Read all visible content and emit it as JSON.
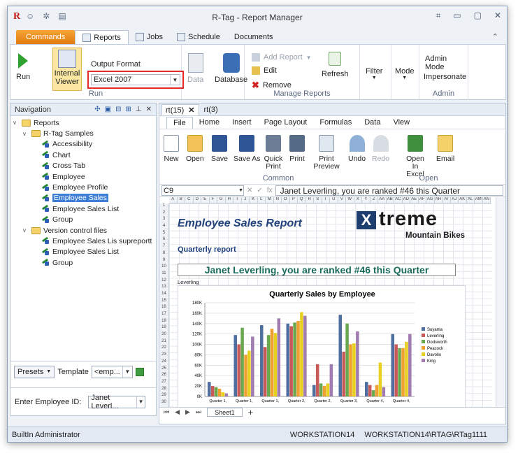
{
  "window": {
    "title": "R-Tag - Report Manager"
  },
  "tabs": [
    {
      "label": "Commands"
    },
    {
      "label": "Reports"
    },
    {
      "label": "Jobs"
    },
    {
      "label": "Schedule"
    },
    {
      "label": "Documents"
    }
  ],
  "ribbon": {
    "run": "Run",
    "internal_viewer": "Internal Viewer",
    "output_format_label": "Output Format",
    "output_format_value": "Excel 2007",
    "run_group": "Run",
    "data": "Data",
    "database": "Database",
    "add_report": "Add Report",
    "edit": "Edit",
    "remove": "Remove",
    "refresh": "Refresh",
    "manage_group": "Manage Reports",
    "filter": "Filter",
    "mode": "Mode",
    "admin_mode": "Admin Mode",
    "impersonate": "Impersonate",
    "admin_group": "Admin"
  },
  "navigation": {
    "title": "Navigation",
    "items": [
      {
        "label": "Reports",
        "level": 0,
        "type": "folder",
        "toggle": "v"
      },
      {
        "label": "R-Tag Samples",
        "level": 1,
        "type": "folder",
        "toggle": "v"
      },
      {
        "label": "Accessibility",
        "level": 2,
        "type": "report"
      },
      {
        "label": "Chart",
        "level": 2,
        "type": "report"
      },
      {
        "label": "Cross Tab",
        "level": 2,
        "type": "report"
      },
      {
        "label": "Employee",
        "level": 2,
        "type": "report2"
      },
      {
        "label": "Employee  Profile",
        "level": 2,
        "type": "report"
      },
      {
        "label": "Employee  Sales",
        "level": 2,
        "type": "report",
        "selected": true
      },
      {
        "label": "Employee Sales List",
        "level": 2,
        "type": "report"
      },
      {
        "label": "Group",
        "level": 2,
        "type": "report"
      },
      {
        "label": "Version control files",
        "level": 1,
        "type": "folder",
        "toggle": "v"
      },
      {
        "label": "Employee Sales Lis  supreportt",
        "level": 2,
        "type": "report3"
      },
      {
        "label": "Employee Sales List",
        "level": 2,
        "type": "report3"
      },
      {
        "label": "Group",
        "level": 2,
        "type": "report3"
      }
    ],
    "presets": "Presets",
    "template_label": "Template",
    "template_value": "<emp...",
    "employee_label": "Enter Employee ID:",
    "employee_value": "Janet Leverl..."
  },
  "doc_tabs": [
    {
      "label": "rt(15)",
      "active": true
    },
    {
      "label": "rt(3)",
      "active": false
    }
  ],
  "excel": {
    "tabs": [
      "File",
      "Home",
      "Insert",
      "Page Layout",
      "Formulas",
      "Data",
      "View"
    ],
    "buttons": {
      "new": "New",
      "open": "Open",
      "save": "Save",
      "save_as": "Save As",
      "quick_print": "Quick Print",
      "print": "Print",
      "print_preview": "Print Preview",
      "undo": "Undo",
      "redo": "Redo",
      "open_in_excel": "Open In Excel",
      "email": "Email"
    },
    "common_group": "Common",
    "open_group": "Open",
    "cell_ref": "C9",
    "formula": "Janet Leverling, you are ranked #46 this Quarter",
    "sheet_tab": "Sheet1",
    "column_letters": [
      "A",
      "B",
      "C",
      "D",
      "E",
      "F",
      "G",
      "H",
      "I",
      "J",
      "K",
      "L",
      "M",
      "N",
      "O",
      "P",
      "Q",
      "R",
      "S",
      "T",
      "U",
      "V",
      "W",
      "X",
      "Y",
      "Z",
      "AA",
      "AB",
      "AC",
      "AD",
      "AE",
      "AF",
      "AG",
      "AH",
      "AI",
      "AJ",
      "AK",
      "AL",
      "AM",
      "AN"
    ],
    "row_numbers": [
      "1",
      "2",
      "3",
      "4",
      "5",
      "6",
      "7",
      "8",
      "9",
      "10",
      "11",
      "12",
      "13",
      "14",
      "15",
      "16",
      "17",
      "18",
      "19",
      "20",
      "21",
      "22",
      "23",
      "24",
      "25",
      "26",
      "27",
      "28",
      "29",
      "30"
    ]
  },
  "report": {
    "title": "Employee Sales Report",
    "subtitle": "Quarterly report",
    "logo_x": "X",
    "logo_word": "treme",
    "logo_sub": "Mountain Bikes",
    "banner": "Janet Leverling, you are ranked #46 this Quarter",
    "leverling": "Leverling"
  },
  "chart_data": {
    "type": "bar",
    "title": "Quarterly Sales by Employee",
    "categories": [
      "Quarter 1,",
      "Quarter 1,",
      "Quarter 1,",
      "Quarter 2,",
      "Quarter 2,",
      "Quarter 3,",
      "Quarter 4,",
      "Quarter 4,"
    ],
    "ylim": [
      0,
      180000
    ],
    "yticks": [
      "0K",
      "20K",
      "40K",
      "60K",
      "80K",
      "100K",
      "120K",
      "140K",
      "160K",
      "180K"
    ],
    "legend_position": "right",
    "series": [
      {
        "name": "Suyama",
        "color": "#4f6fa0",
        "values": [
          28000,
          118000,
          137000,
          140000,
          22000,
          157000,
          28000,
          120000
        ]
      },
      {
        "name": "Leverling",
        "color": "#c85a5a",
        "values": [
          20000,
          100000,
          95000,
          135000,
          62000,
          86000,
          22000,
          100000
        ]
      },
      {
        "name": "Dodsworth",
        "color": "#6aa84f",
        "values": [
          18000,
          132000,
          118000,
          142000,
          25000,
          140000,
          12000,
          93000
        ]
      },
      {
        "name": "Peacock",
        "color": "#f0a030",
        "values": [
          15000,
          80000,
          130000,
          145000,
          20000,
          100000,
          22000,
          93000
        ]
      },
      {
        "name": "Davolio",
        "color": "#e8d020",
        "values": [
          8000,
          88000,
          122000,
          162000,
          25000,
          102000,
          65000,
          105000
        ]
      },
      {
        "name": "King",
        "color": "#a07cb0",
        "values": [
          6000,
          115000,
          150000,
          155000,
          62000,
          125000,
          18000,
          120000
        ]
      }
    ]
  },
  "status": {
    "user": "BuiltIn Administrator",
    "workstation": "WORKSTATION14",
    "path": "WORKSTATION14\\RTAG\\RTag1111"
  }
}
